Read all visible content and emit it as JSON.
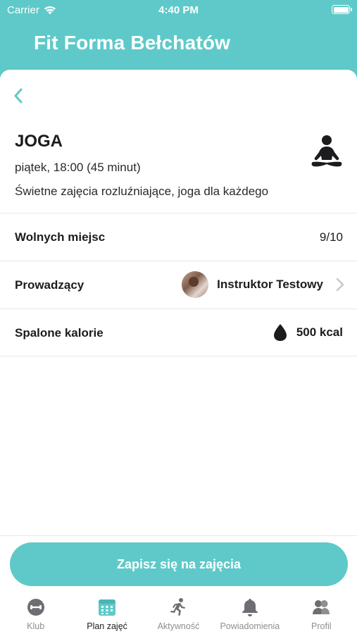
{
  "status_bar": {
    "carrier": "Carrier",
    "time": "4:40 PM"
  },
  "header": {
    "app_title": "Fit Forma Bełchatów"
  },
  "class": {
    "title": "JOGA",
    "time": "piątek, 18:00 (45 minut)",
    "description": "Świetne zajęcia rozluźniające, joga dla każdego",
    "icon": "yoga-meditation-icon"
  },
  "details": {
    "seats_label": "Wolnych miejsc",
    "seats_value": "9/10",
    "instructor_label": "Prowadzący",
    "instructor_name": "Instruktor Testowy",
    "calories_label": "Spalone kalorie",
    "calories_value": "500 kcal"
  },
  "signup_button": "Zapisz się na zajęcia",
  "tabs": [
    {
      "label": "Klub",
      "icon": "dumbbell-icon",
      "active": false
    },
    {
      "label": "Plan zajęć",
      "icon": "calendar-icon",
      "active": true
    },
    {
      "label": "Aktywność",
      "icon": "running-icon",
      "active": false
    },
    {
      "label": "Powiadomienia",
      "icon": "bell-icon",
      "active": false
    },
    {
      "label": "Profil",
      "icon": "users-icon",
      "active": false
    }
  ],
  "colors": {
    "accent": "#5fc9c9",
    "text": "#1c1c1e",
    "muted": "#8e8e93",
    "divider": "#e7e7e9"
  }
}
